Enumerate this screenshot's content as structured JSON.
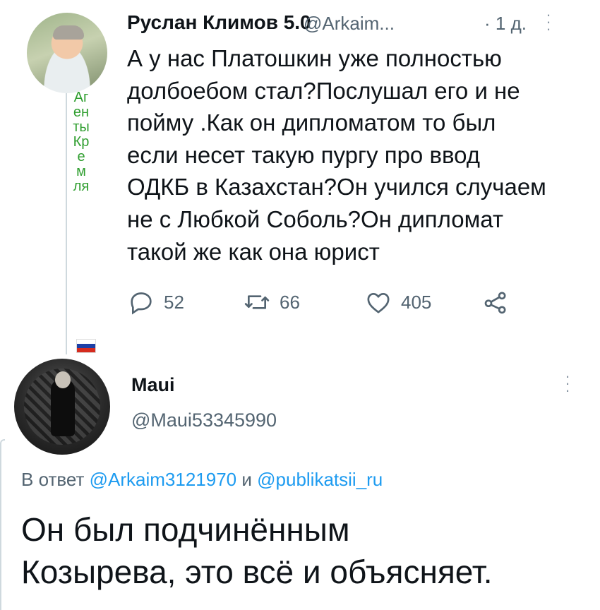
{
  "tweet1": {
    "display_name": "Руслан Климов 5.0",
    "handle": "@Arkaim...",
    "time": "· 1 д.",
    "vertical_name": "АгентыКремля",
    "text_lines": [
      "А у нас Платошкин уже полностью",
      "долбоебом стал?Послушал его и не",
      "пойму .Как он дипломатом то был",
      "если несет такую пургу про ввод",
      "ОДКБ в Казахстан?Он учился случаем",
      "не с Любкой Соболь?Он дипломат",
      "такой же как она юрист"
    ],
    "actions": {
      "replies": "52",
      "retweets": "66",
      "likes": "405"
    },
    "icons": {
      "reply": "reply-icon",
      "retweet": "retweet-icon",
      "like": "heart-icon",
      "share": "share-icon",
      "flag": "russian-flag-icon"
    }
  },
  "tweet2": {
    "display_name": "Maui",
    "handle": "@Maui53345990",
    "reply_prefix": "В ответ ",
    "reply_mention_1": "@Arkaim3121970",
    "reply_conjunction": " и ",
    "reply_mention_2": "@publikatsii_ru",
    "text_lines": [
      "Он был подчинённым",
      "Козырева, это всё и объясняет."
    ]
  },
  "colors": {
    "text": "#0f1419",
    "secondary": "#536471",
    "link": "#1d9bf0",
    "vertical_name": "#2f9e2f",
    "thread_line": "#cfd9de"
  }
}
